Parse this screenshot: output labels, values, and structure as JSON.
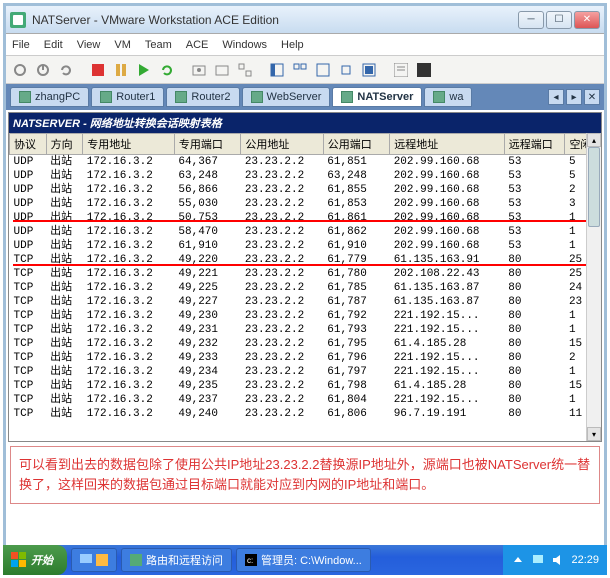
{
  "window": {
    "title": "NATServer - VMware Workstation ACE Edition"
  },
  "menu": [
    "File",
    "Edit",
    "View",
    "VM",
    "Team",
    "ACE",
    "Windows",
    "Help"
  ],
  "tabs": {
    "items": [
      {
        "label": "zhangPC"
      },
      {
        "label": "Router1"
      },
      {
        "label": "Router2"
      },
      {
        "label": "WebServer"
      },
      {
        "label": "NATServer"
      },
      {
        "label": "wa"
      }
    ],
    "active": 4
  },
  "table": {
    "title": "NATSERVER - 网络地址转换会话映射表格",
    "columns": [
      "协议",
      "方向",
      "专用地址",
      "专用端口",
      "公用地址",
      "公用端口",
      "远程地址",
      "远程端口",
      "空闲"
    ],
    "rows": [
      [
        "UDP",
        "出站",
        "172.16.3.2",
        "64,367",
        "23.23.2.2",
        "61,851",
        "202.99.160.68",
        "53",
        "5"
      ],
      [
        "UDP",
        "出站",
        "172.16.3.2",
        "63,248",
        "23.23.2.2",
        "63,248",
        "202.99.160.68",
        "53",
        "5"
      ],
      [
        "UDP",
        "出站",
        "172.16.3.2",
        "56,866",
        "23.23.2.2",
        "61,855",
        "202.99.160.68",
        "53",
        "2"
      ],
      [
        "UDP",
        "出站",
        "172.16.3.2",
        "55,030",
        "23.23.2.2",
        "61,853",
        "202.99.160.68",
        "53",
        "3"
      ],
      [
        "UDP",
        "出站",
        "172.16.3.2",
        "50,753",
        "23.23.2.2",
        "61,861",
        "202.99.160.68",
        "53",
        "1"
      ],
      [
        "UDP",
        "出站",
        "172.16.3.2",
        "58,470",
        "23.23.2.2",
        "61,862",
        "202.99.160.68",
        "53",
        "1"
      ],
      [
        "UDP",
        "出站",
        "172.16.3.2",
        "61,910",
        "23.23.2.2",
        "61,910",
        "202.99.160.68",
        "53",
        "1"
      ],
      [
        "TCP",
        "出站",
        "172.16.3.2",
        "49,220",
        "23.23.2.2",
        "61,779",
        "61.135.163.91",
        "80",
        "25"
      ],
      [
        "TCP",
        "出站",
        "172.16.3.2",
        "49,221",
        "23.23.2.2",
        "61,780",
        "202.108.22.43",
        "80",
        "25"
      ],
      [
        "TCP",
        "出站",
        "172.16.3.2",
        "49,225",
        "23.23.2.2",
        "61,785",
        "61.135.163.87",
        "80",
        "24"
      ],
      [
        "TCP",
        "出站",
        "172.16.3.2",
        "49,227",
        "23.23.2.2",
        "61,787",
        "61.135.163.87",
        "80",
        "23"
      ],
      [
        "TCP",
        "出站",
        "172.16.3.2",
        "49,230",
        "23.23.2.2",
        "61,792",
        "221.192.15...",
        "80",
        "1"
      ],
      [
        "TCP",
        "出站",
        "172.16.3.2",
        "49,231",
        "23.23.2.2",
        "61,793",
        "221.192.15...",
        "80",
        "1"
      ],
      [
        "TCP",
        "出站",
        "172.16.3.2",
        "49,232",
        "23.23.2.2",
        "61,795",
        "61.4.185.28",
        "80",
        "15"
      ],
      [
        "TCP",
        "出站",
        "172.16.3.2",
        "49,233",
        "23.23.2.2",
        "61,796",
        "221.192.15...",
        "80",
        "2"
      ],
      [
        "TCP",
        "出站",
        "172.16.3.2",
        "49,234",
        "23.23.2.2",
        "61,797",
        "221.192.15...",
        "80",
        "1"
      ],
      [
        "TCP",
        "出站",
        "172.16.3.2",
        "49,235",
        "23.23.2.2",
        "61,798",
        "61.4.185.28",
        "80",
        "15"
      ],
      [
        "TCP",
        "出站",
        "172.16.3.2",
        "49,237",
        "23.23.2.2",
        "61,804",
        "221.192.15...",
        "80",
        "1"
      ],
      [
        "TCP",
        "出站",
        "172.16.3.2",
        "49,240",
        "23.23.2.2",
        "61,806",
        "96.7.19.191",
        "80",
        "11"
      ]
    ]
  },
  "note_text": "可以看到出去的数据包除了使用公共IP地址23.23.2.2替换源IP地址外，源端口也被NATServer统一替换了，这样回来的数据包通过目标端口就能对应到内网的IP地址和端口。",
  "taskbar": {
    "start": "开始",
    "items": [
      {
        "label": "路由和远程访问"
      },
      {
        "label": "管理员: C:\\Window..."
      }
    ],
    "clock": "22:29"
  }
}
